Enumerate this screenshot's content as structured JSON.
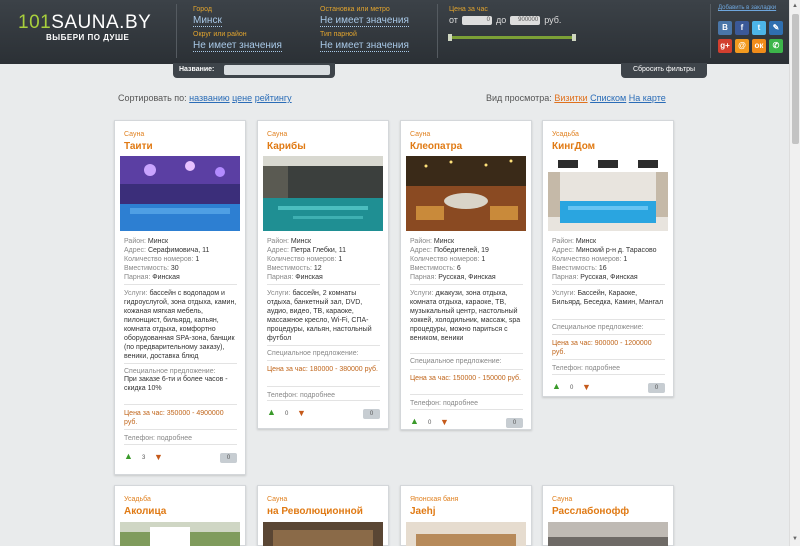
{
  "header": {
    "logo_main": "101",
    "logo_rest": "SAUNA.BY",
    "tagline": "ВЫБЕРИ ПО ДУШЕ",
    "filters": {
      "city_label": "Город",
      "city_value": "Минск",
      "district_label": "Округ или район",
      "district_value": "Не имеет значения",
      "stop_label": "Остановка или метро",
      "stop_value": "Не имеет значения",
      "steam_label": "Тип парной",
      "steam_value": "Не имеет значения",
      "price_label": "Цена за час",
      "price_from_label": "от",
      "price_from": "0",
      "price_to_label": "до",
      "price_to": "900000",
      "price_unit": "руб."
    },
    "bookmarks_label": "Добавить в закладки",
    "social": [
      {
        "name": "vkontakte-icon",
        "glyph": "В",
        "color": "#4a76a8"
      },
      {
        "name": "facebook-icon",
        "glyph": "f",
        "color": "#3b5998"
      },
      {
        "name": "twitter-icon",
        "glyph": "t",
        "color": "#4db5e8"
      },
      {
        "name": "livejournal-icon",
        "glyph": "✎",
        "color": "#2f6fb0"
      },
      {
        "name": "google-plus-icon",
        "glyph": "g+",
        "color": "#d23f2f"
      },
      {
        "name": "mail-icon",
        "glyph": "@",
        "color": "#f29a1f"
      },
      {
        "name": "odnoklassniki-icon",
        "glyph": "ок",
        "color": "#f08c1a"
      },
      {
        "name": "whatsapp-icon",
        "glyph": "✆",
        "color": "#3cb54a"
      }
    ]
  },
  "search": {
    "name_label": "Название:",
    "name_value": "",
    "reset_label": "Сбросить фильтры"
  },
  "sort": {
    "label": "Сортировать по:",
    "by_name": "названию",
    "by_price": "цене",
    "by_rating": "рейтингу"
  },
  "view": {
    "label": "Вид просмотра:",
    "cards": "Визитки",
    "list": "Списком",
    "map": "На карте"
  },
  "labels": {
    "district": "Район:",
    "address": "Адрес:",
    "rooms": "Количество номеров:",
    "capacity": "Вместимость:",
    "steam": "Парная:",
    "services": "Услуги:",
    "special": "Специальное предложение:",
    "price": "Цена за час:",
    "phone": "Телефон:",
    "phone_more": "подробнее"
  },
  "cards": [
    {
      "type": "Сауна",
      "name": "Таити",
      "district": "Минск",
      "address": "Серафимовича, 11",
      "rooms": "1",
      "capacity": "30",
      "steam": "Финская",
      "services": "бассейн с водопадом и гидроуслугой, зона отдыха, камин, кожаная мягкая мебель, пилонщист, бильярд, кальян, комната отдыха, комфортно оборудованная SPA-зона, банщик (по предварительному заказу), веники, доставка блюд",
      "special": "При заказе 6-ти и более часов - скидка 10%",
      "price": "350000 - 4900000 руб.",
      "likes": "3",
      "comments": "0"
    },
    {
      "type": "Сауна",
      "name": "Карибы",
      "district": "Минск",
      "address": "Петра Глебки, 11",
      "rooms": "1",
      "capacity": "12",
      "steam": "Финская",
      "services": "бассейн, 2 комнаты отдыха, банкетный зал, DVD, аудио, видео, ТВ, караоке, массажное кресло, Wi-Fi, СПА-процедуры, кальян, настольный футбол",
      "special": "",
      "price": "180000 - 380000 руб.",
      "likes": "0",
      "comments": "0"
    },
    {
      "type": "Сауна",
      "name": "Клеопатра",
      "district": "Минск",
      "address": "Победителей, 19",
      "rooms": "1",
      "capacity": "6",
      "steam": "Русская, Финская",
      "services": "джакузи, зона отдыха, комната отдыха, караоке, ТВ, музыкальный центр, настольный хоккей, холодильник, массаж, spa процедуры, можно париться с веником, веники",
      "special": "",
      "price": "150000 - 150000 руб.",
      "likes": "0",
      "comments": "0"
    },
    {
      "type": "Усадьба",
      "name": "КингДом",
      "district": "Минск",
      "address": "Минский р-н д. Тарасово",
      "rooms": "1",
      "capacity": "16",
      "steam": "Русская, Финская",
      "services": "Бассейн, Караоке, Бильярд, Беседка, Камин, Мангал",
      "special": "",
      "price": "900000 - 1200000 руб.",
      "likes": "0",
      "comments": "0"
    }
  ],
  "cards_row2": [
    {
      "type": "Усадьба",
      "name": "Аколица"
    },
    {
      "type": "Сауна",
      "name": "на Революционной"
    },
    {
      "type": "Японская баня",
      "name": "Jaehj"
    },
    {
      "type": "Сауна",
      "name": "Расслабонофф"
    }
  ]
}
